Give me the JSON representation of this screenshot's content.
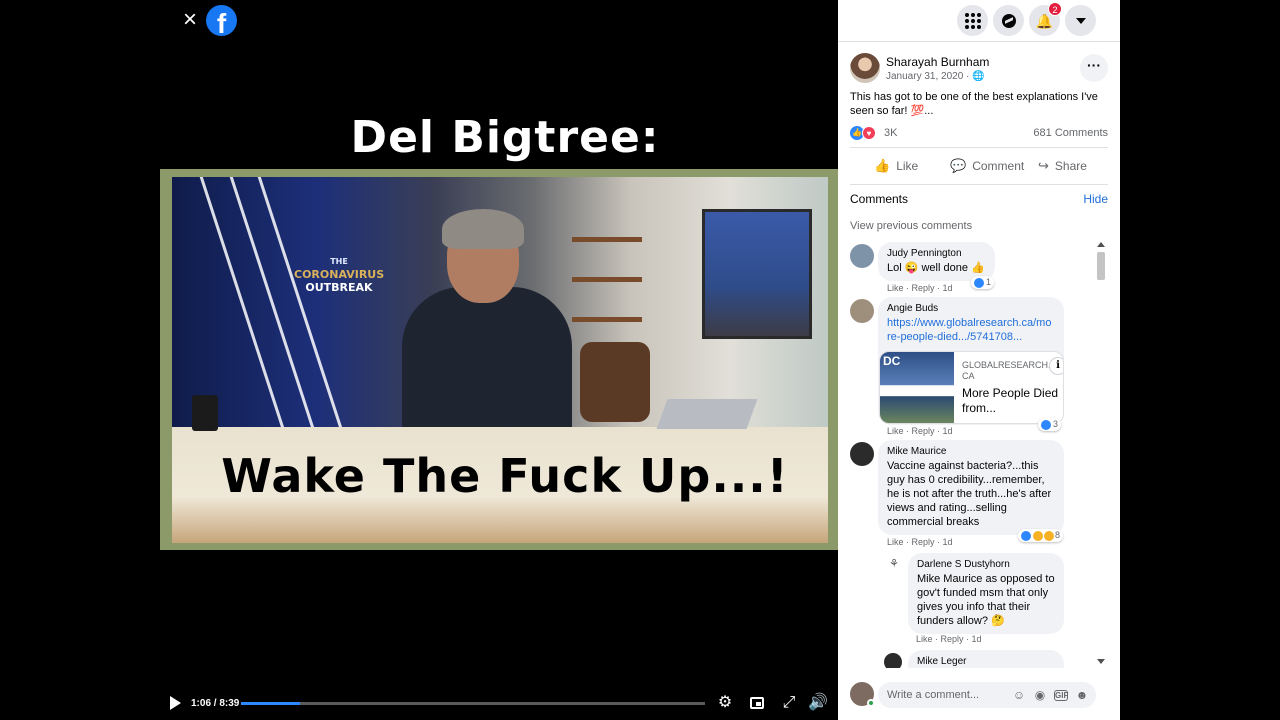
{
  "video": {
    "close_icon": "×",
    "logo_letter": "f",
    "title_overlay": "Del Bigtree:",
    "scene_logo_line1": "THE",
    "scene_logo_line2": "CORONAVIRUS",
    "scene_logo_line3": "OUTBREAK",
    "caption_overlay": "Wake The Fuck Up...!",
    "time": "1:06 / 8:39",
    "progress_fraction": 0.127,
    "icons": [
      "play-icon",
      "settings-icon",
      "picture-in-picture-icon",
      "fullscreen-icon",
      "volume-icon"
    ]
  },
  "topbar": {
    "notification_count": "2",
    "icons": [
      "menu-grid-icon",
      "messenger-icon",
      "bell-icon",
      "chevron-down-icon"
    ]
  },
  "post": {
    "author": "Sharayah Burnham",
    "date": "January 31, 2020 · ",
    "privacy_icon": "globe-icon",
    "text": "This has got to be one of the best explanations I've seen so far! 💯...",
    "reaction_count": "3K",
    "comment_count": "681 Comments",
    "actions": {
      "like": "Like",
      "comment": "Comment",
      "share": "Share"
    }
  },
  "comments_section": {
    "heading": "Comments",
    "hide": "Hide",
    "view_previous": "View previous comments",
    "items": [
      {
        "name": "Judy Pennington",
        "text": "Lol 😜 well done 👍",
        "like": "Like",
        "reply": "Reply",
        "age": "1d",
        "reactions": "1"
      },
      {
        "name": "Angie Buds",
        "link": "https://www.globalresearch.ca/more-people-died.../5741708...",
        "card_domain": "GLOBALRESEARCH.CA",
        "card_title": "More People Died from...",
        "card_image_text": "DC",
        "like": "Like",
        "reply": "Reply",
        "age": "1d",
        "reactions": "3"
      },
      {
        "name": "Mike Maurice",
        "text": "Vaccine against bacteria?...this guy has 0 credibility...remember, he is not after the truth...he's after views and rating...selling commercial breaks",
        "like": "Like",
        "reply": "Reply",
        "age": "1d",
        "reactions": "8"
      },
      {
        "name": "Darlene S Dustyhorn",
        "mention": "Mike Maurice",
        "text": " as opposed to gov't funded msm that only gives you info that their funders allow? 🤔",
        "like": "Like",
        "reply": "Reply",
        "age": "1d"
      },
      {
        "name": "Mike Leger"
      }
    ]
  },
  "composer": {
    "placeholder": "Write a comment...",
    "icons": [
      "emoji-icon",
      "camera-icon",
      "gif-icon",
      "sticker-icon"
    ]
  }
}
